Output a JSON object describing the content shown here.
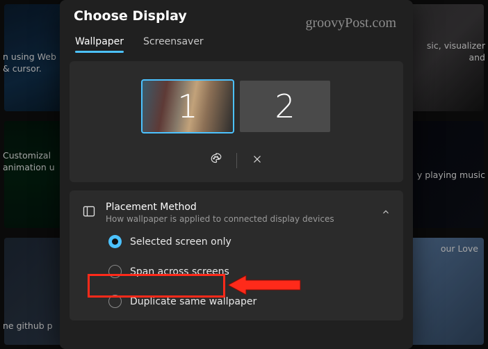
{
  "background": {
    "tiles": [
      {
        "caption": "n using Web & cursor."
      },
      {
        "caption": ""
      },
      {
        "caption": "sic, visualizer and"
      },
      {
        "caption": "Customizal animation u"
      },
      {
        "caption": ""
      },
      {
        "caption": "y playing music"
      },
      {
        "caption": "ne github p"
      },
      {
        "caption": ""
      },
      {
        "caption": "our Love"
      }
    ]
  },
  "watermark": "groovyPost.com",
  "dialog": {
    "title": "Choose Display",
    "tabs": [
      {
        "label": "Wallpaper",
        "active": true
      },
      {
        "label": "Screensaver",
        "active": false
      }
    ],
    "displays": [
      {
        "number": "1",
        "selected": true
      },
      {
        "number": "2",
        "selected": false
      }
    ],
    "actions": {
      "customize": "customize-icon",
      "close": "close-icon"
    },
    "placement": {
      "title": "Placement Method",
      "subtitle": "How wallpaper is applied to connected display devices",
      "expanded": true,
      "options": [
        {
          "label": "Selected screen only",
          "selected": true
        },
        {
          "label": "Span across screens",
          "selected": false
        },
        {
          "label": "Duplicate same wallpaper",
          "selected": false
        }
      ]
    }
  }
}
